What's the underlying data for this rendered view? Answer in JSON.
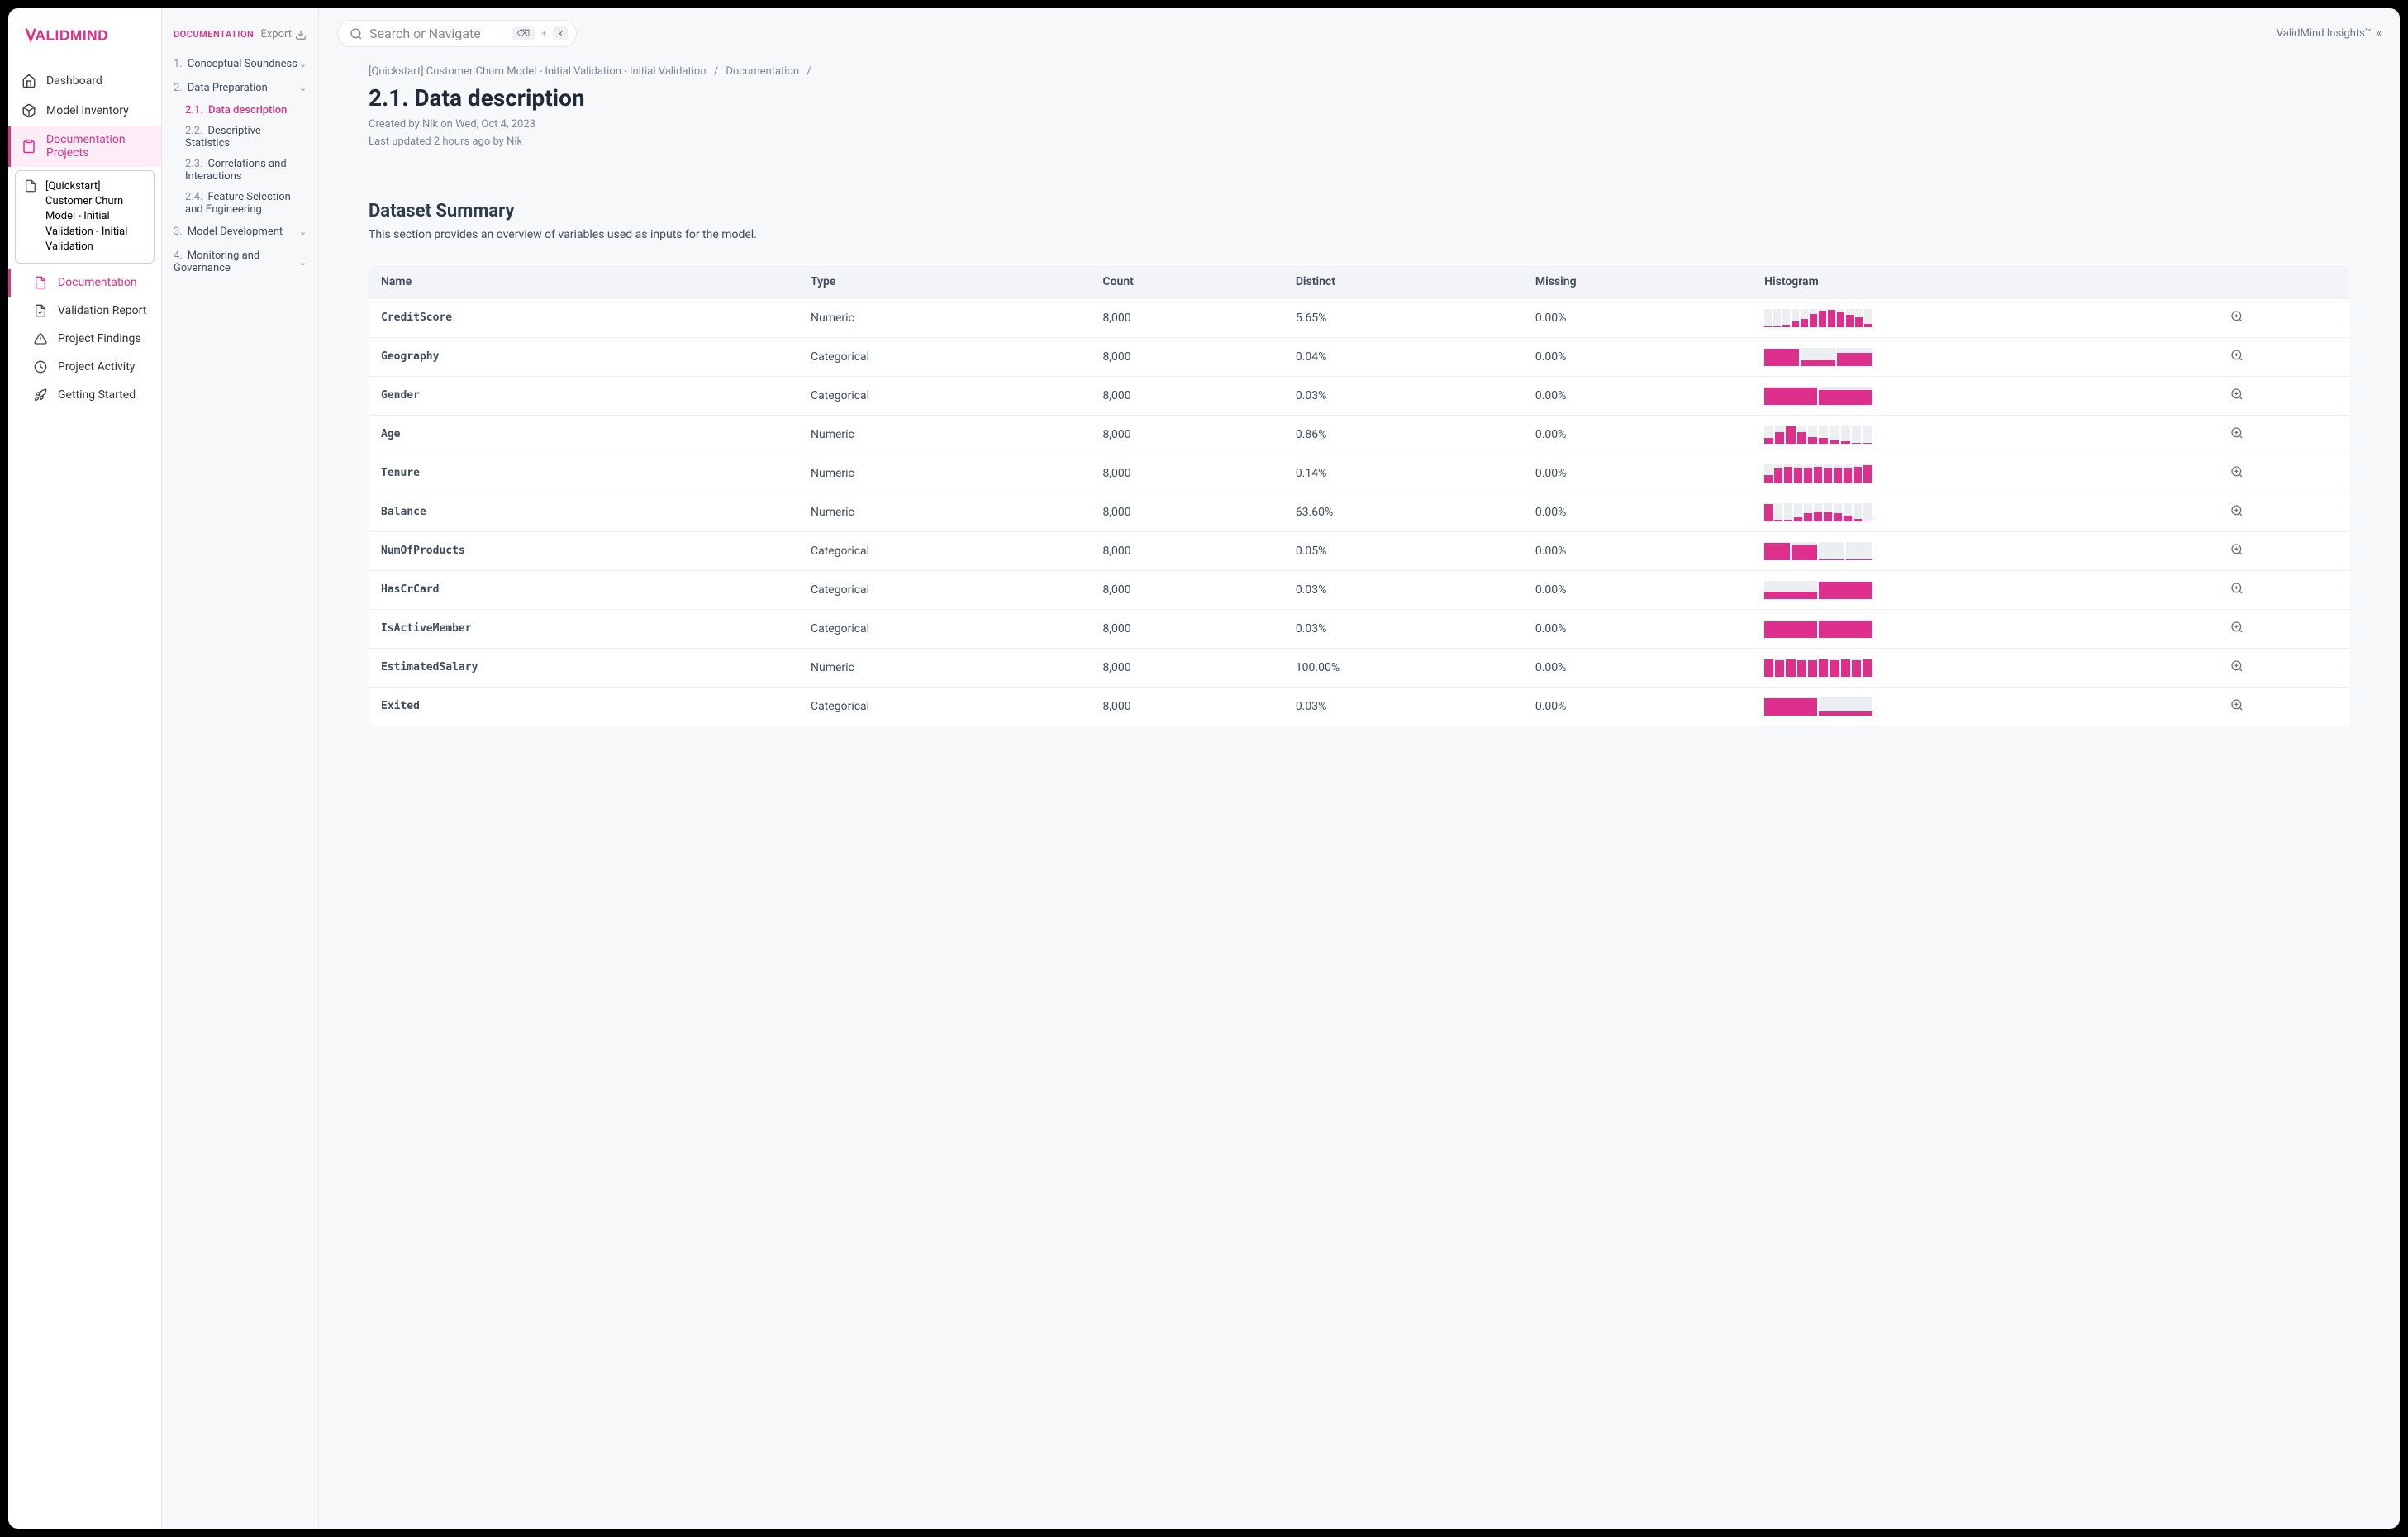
{
  "brand": {
    "name": "ValidMind",
    "accent": "#de2f8d"
  },
  "primary_nav": [
    {
      "icon": "home",
      "label": "Dashboard"
    },
    {
      "icon": "cube",
      "label": "Model Inventory"
    },
    {
      "icon": "docs",
      "label": "Documentation Projects"
    }
  ],
  "project_card": {
    "title": "[Quickstart] Customer Churn Model - Initial Validation - Initial Validation"
  },
  "project_nav": [
    {
      "icon": "file",
      "label": "Documentation",
      "active": true
    },
    {
      "icon": "check",
      "label": "Validation Report"
    },
    {
      "icon": "warn",
      "label": "Project Findings"
    },
    {
      "icon": "clock",
      "label": "Project Activity"
    },
    {
      "icon": "rocket",
      "label": "Getting Started"
    }
  ],
  "secondary": {
    "title": "DOCUMENTATION",
    "export": "Export",
    "toc": [
      {
        "num": "1.",
        "label": "Conceptual Soundness",
        "expand": true
      },
      {
        "num": "2.",
        "label": "Data Preparation",
        "expand": true,
        "children": [
          {
            "num": "2.1.",
            "label": "Data description",
            "active": true
          },
          {
            "num": "2.2.",
            "label": "Descriptive Statistics"
          },
          {
            "num": "2.3.",
            "label": "Correlations and Interactions"
          },
          {
            "num": "2.4.",
            "label": "Feature Selection and Engineering"
          }
        ]
      },
      {
        "num": "3.",
        "label": "Model Development",
        "expand": true
      },
      {
        "num": "4.",
        "label": "Monitoring and Governance",
        "expand": true
      }
    ]
  },
  "topbar": {
    "search_placeholder": "Search or Navigate",
    "kbd_clear": "⌫",
    "kbd_plus": "+",
    "kbd_k": "k",
    "insights": "ValidMind Insights™"
  },
  "crumbs": [
    "[Quickstart] Customer Churn Model - Initial Validation - Initial Validation",
    "Documentation"
  ],
  "page": {
    "title": "2.1. Data description",
    "created": "Created by Nik on Wed, Oct 4, 2023",
    "updated": "Last updated 2 hours ago by Nik"
  },
  "section": {
    "title": "Dataset Summary",
    "description": "This section provides an overview of variables used as inputs for the model.",
    "columns": [
      "Name",
      "Type",
      "Count",
      "Distinct",
      "Missing",
      "Histogram",
      ""
    ],
    "rows": [
      {
        "name": "CreditScore",
        "type": "Numeric",
        "count": "8,000",
        "distinct": "5.65%",
        "missing": "0.00%",
        "hist": [
          5,
          4,
          10,
          28,
          45,
          72,
          88,
          95,
          80,
          68,
          55,
          18
        ]
      },
      {
        "name": "Geography",
        "type": "Categorical",
        "count": "8,000",
        "distinct": "0.04%",
        "missing": "0.00%",
        "hist": [
          95,
          30,
          70
        ]
      },
      {
        "name": "Gender",
        "type": "Categorical",
        "count": "8,000",
        "distinct": "0.03%",
        "missing": "0.00%",
        "hist": [
          95,
          80
        ]
      },
      {
        "name": "Age",
        "type": "Numeric",
        "count": "8,000",
        "distinct": "0.86%",
        "missing": "0.00%",
        "hist": [
          30,
          60,
          95,
          60,
          35,
          30,
          18,
          10,
          5,
          3
        ]
      },
      {
        "name": "Tenure",
        "type": "Numeric",
        "count": "8,000",
        "distinct": "0.14%",
        "missing": "0.00%",
        "hist": [
          40,
          82,
          86,
          80,
          82,
          84,
          80,
          78,
          82,
          84,
          95
        ]
      },
      {
        "name": "Balance",
        "type": "Numeric",
        "count": "8,000",
        "distinct": "63.60%",
        "missing": "0.00%",
        "hist": [
          95,
          6,
          8,
          22,
          42,
          55,
          50,
          45,
          30,
          12,
          4
        ]
      },
      {
        "name": "NumOfProducts",
        "type": "Categorical",
        "count": "8,000",
        "distinct": "0.05%",
        "missing": "0.00%",
        "hist": [
          95,
          85,
          8,
          4
        ]
      },
      {
        "name": "HasCrCard",
        "type": "Categorical",
        "count": "8,000",
        "distinct": "0.03%",
        "missing": "0.00%",
        "hist": [
          38,
          95
        ]
      },
      {
        "name": "IsActiveMember",
        "type": "Categorical",
        "count": "8,000",
        "distinct": "0.03%",
        "missing": "0.00%",
        "hist": [
          90,
          95
        ]
      },
      {
        "name": "EstimatedSalary",
        "type": "Numeric",
        "count": "8,000",
        "distinct": "100.00%",
        "missing": "0.00%",
        "hist": [
          92,
          90,
          95,
          88,
          90,
          93,
          90,
          92,
          89,
          94
        ]
      },
      {
        "name": "Exited",
        "type": "Categorical",
        "count": "8,000",
        "distinct": "0.03%",
        "missing": "0.00%",
        "hist": [
          95,
          22
        ]
      }
    ]
  }
}
